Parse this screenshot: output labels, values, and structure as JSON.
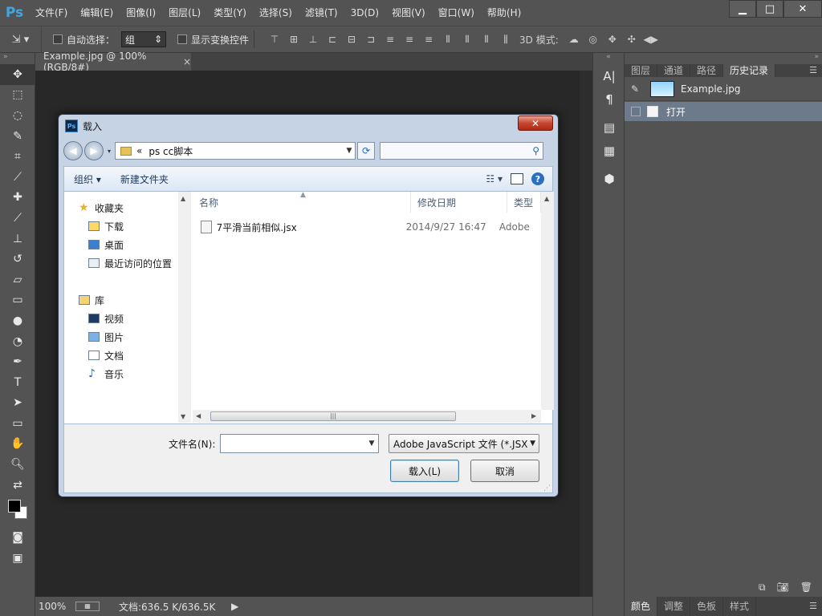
{
  "app": {
    "logo": "Ps",
    "menu": [
      "文件(F)",
      "编辑(E)",
      "图像(I)",
      "图层(L)",
      "类型(Y)",
      "选择(S)",
      "滤镜(T)",
      "3D(D)",
      "视图(V)",
      "窗口(W)",
      "帮助(H)"
    ],
    "window_buttons": {
      "minimize": "▁",
      "maximize": "□",
      "close": "✕"
    }
  },
  "options_bar": {
    "auto_select_label": "自动选择：",
    "auto_select_value": "组",
    "show_transform_label": "显示变换控件",
    "mode_3d_label": "3D 模式:"
  },
  "document": {
    "tab_title": "Example.jpg @ 100%(RGB/8#)",
    "tab_close": "×",
    "zoom": "100%",
    "doc_info": "文档:636.5 K/636.5K"
  },
  "panels": {
    "tabs": [
      "图层",
      "通道",
      "路径",
      "历史记录"
    ],
    "active_tab": "历史记录",
    "history": {
      "snapshot_label": "Example.jpg",
      "items": [
        {
          "label": "打开"
        }
      ]
    },
    "bottom_tabs": [
      "颜色",
      "调整",
      "色板",
      "样式"
    ]
  },
  "dialog": {
    "title": "载入",
    "close_label": "✕",
    "address_prefix": "«",
    "address_path": "ps cc脚本",
    "search_placeholder": "",
    "toolbar": {
      "organize": "组织 ▾",
      "new_folder": "新建文件夹"
    },
    "nav": {
      "favorites_label": "收藏夹",
      "favorites": [
        "下载",
        "桌面",
        "最近访问的位置"
      ],
      "libraries_label": "库",
      "libraries": [
        "视频",
        "图片",
        "文档",
        "音乐"
      ]
    },
    "columns": {
      "name": "名称",
      "date": "修改日期",
      "type": "类型"
    },
    "files": [
      {
        "name": "7平滑当前相似.jsx",
        "date": "2014/9/27 16:47",
        "type": "Adobe"
      }
    ],
    "filename_label": "文件名(N):",
    "filename_value": "",
    "filetype_value": "Adobe JavaScript 文件 (*.JSX",
    "load_button": "载入(L)",
    "cancel_button": "取消"
  }
}
